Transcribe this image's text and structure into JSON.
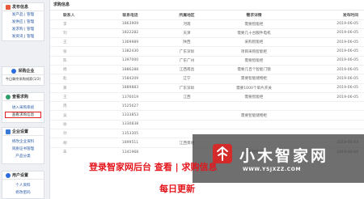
{
  "sidebar": {
    "publish": {
      "title": "发布信息",
      "icon_color": "#e85a3c",
      "items": [
        "发产品 | 管理",
        "发供应 | 管理",
        "发求购 | 管理",
        "发资讯 | 管理"
      ]
    },
    "pay": {
      "title": "采购企业",
      "icon_color": "#2d6cdf",
      "items": [
        "今日剩余采购线索(1/2)"
      ]
    },
    "purchase": {
      "title": "查看求购",
      "icon_color": "#2d9f6a",
      "items": [
        "进入采购系统",
        "查看求购信息"
      ]
    },
    "company": {
      "title": "企业设置",
      "icon_color": "#3a7bd5",
      "items": [
        "修改企业资料",
        "资质证书管理",
        "产品分类"
      ]
    },
    "user": {
      "title": "用户设置",
      "icon_color": "#2d6cdf",
      "items": [
        "个人资料",
        "修改密码"
      ]
    }
  },
  "main": {
    "title": "求购信息",
    "columns": [
      "联系人",
      "联系电话",
      "所属地区",
      "需求详情",
      "发布时间"
    ],
    "rows": [
      {
        "name": "李",
        "phone": "1863909",
        "region": "河南",
        "detail": "需要智能柜",
        "date": "2019-06-05"
      },
      {
        "name": "刘",
        "phone": "1822282",
        "region": "天津",
        "detail": "需要几十台服件电机",
        "date": "2019-06-05"
      },
      {
        "name": "王",
        "phone": "1369989",
        "region": "陕西",
        "detail": "采购智能柜",
        "date": "2019-06-05"
      },
      {
        "name": "张",
        "phone": "1382430",
        "region": "广东深圳",
        "detail": "项目采购智能柜",
        "date": "2019-06-05"
      },
      {
        "name": "陈",
        "phone": "1397000",
        "region": "广东广州",
        "detail": "需要智能柜",
        "date": "2019-06-05"
      },
      {
        "name": "杨",
        "phone": "1886288",
        "region": "江西南昌",
        "detail": "需要几百个智能门锁",
        "date": "2019-06-05"
      },
      {
        "name": "赵",
        "phone": "1584209",
        "region": "辽宁",
        "detail": "需要智能储物柜",
        "date": "2019-06-05"
      },
      {
        "name": "黄",
        "phone": "1889883",
        "region": "广东深圳",
        "detail": "需要1000个单片开关",
        "date": "2019-06-05"
      },
      {
        "name": "王",
        "phone": "1376019",
        "region": "江西",
        "detail": "需要智能柜",
        "date": "2019-06-05"
      },
      {
        "name": "周",
        "phone": "1525627",
        "region": "",
        "detail": "",
        "date": ""
      },
      {
        "name": "吴",
        "phone": "1333853",
        "region": "",
        "detail": "需要智能储物柜",
        "date": ""
      },
      {
        "name": "徐",
        "phone": "1330838",
        "region": "",
        "detail": "",
        "date": ""
      },
      {
        "name": "孙",
        "phone": "1353305",
        "region": "",
        "detail": "",
        "date": ""
      },
      {
        "name": "胡",
        "phone": "1899511",
        "region": "江西景德",
        "detail": "",
        "date": "2019-06-04"
      },
      {
        "name": "朱",
        "phone": "1341968",
        "region": "",
        "detail": "采购智能柜",
        "date": "2019-06-04"
      }
    ]
  },
  "overlay": {
    "brand_cn": "小木智家网",
    "brand_url": "WWW.YSJXZZ.COM",
    "red_line_1": "登录智家网后台  查看 | 求购信息",
    "red_line_2": "每日更新",
    "logo_color": "#d42a2a"
  }
}
